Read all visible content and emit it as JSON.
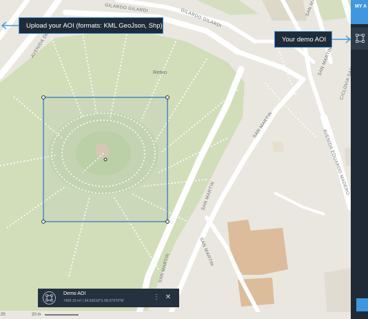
{
  "map": {
    "streets": [
      "GILARDO GILARDI",
      "GILARDO GILARDI",
      "AVENIDA DEL",
      "SAN MARTIN",
      "SAN MARTIN",
      "SAN MARTIN",
      "SAN MARTIN",
      "AVENIDA EDUARDO MADERO",
      "CICLOVIA SAN MARTIN",
      "SAN MARTIN",
      "SAN MARTIN"
    ],
    "place": "Retiro"
  },
  "tooltips": {
    "upload": "Upload your AOI (formats: KML GeoJson, Shp)",
    "demo": "Your demo AOI"
  },
  "panel": {
    "tab_label": "MY A"
  },
  "aoi_card": {
    "name": "Demo AOI",
    "meta": "7492.15 m² | 34.59218°S 58.37373°W",
    "more": "⋮",
    "close": "✕"
  },
  "scale": {
    "left": "25",
    "label": "20 m"
  },
  "colors": {
    "accent": "#3e97df",
    "panel": "#1f2a36",
    "park": "#d2ddba",
    "inner_park": "#c3d6a8",
    "aoi_stroke": "#3e7fc4"
  }
}
